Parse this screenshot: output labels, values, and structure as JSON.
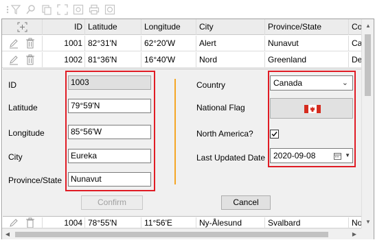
{
  "toolbar": {
    "icons": [
      "filter-icon",
      "search-icon",
      "copy-icon",
      "select-area-icon",
      "photo-icon",
      "print-icon",
      "snapshot-icon"
    ]
  },
  "grid": {
    "columns": [
      "",
      "ID",
      "Latitude",
      "Longitude",
      "City",
      "Province/State",
      "Co"
    ],
    "rows": [
      {
        "id": "1001",
        "latitude": "82°31'N",
        "longitude": "62°20'W",
        "city": "Alert",
        "province": "Nunavut",
        "country": "Ca"
      },
      {
        "id": "1002",
        "latitude": "81°36'N",
        "longitude": "16°40'W",
        "city": "Nord",
        "province": "Greenland",
        "country": "De"
      },
      {
        "id": "1004",
        "latitude": "78°55'N",
        "longitude": "11°56'E",
        "city": "Ny-Ålesund",
        "province": "Svalbard",
        "country": "No"
      }
    ]
  },
  "form": {
    "id_label": "ID",
    "id_value": "1003",
    "latitude_label": "Latitude",
    "latitude_value": "79°59'N",
    "longitude_label": "Longitude",
    "longitude_value": "85°56'W",
    "city_label": "City",
    "city_value": "Eureka",
    "province_label": "Province/State",
    "province_value": "Nunavut",
    "country_label": "Country",
    "country_value": "Canada",
    "flag_label": "National Flag",
    "north_america_label": "North America?",
    "north_america_checked": true,
    "date_label": "Last Updated Date",
    "date_value": "2020-09-08",
    "confirm_label": "Confirm",
    "cancel_label": "Cancel"
  },
  "colors": {
    "highlight": "#e01b24",
    "divider": "#f5a623",
    "flag_red": "#d52b1e"
  }
}
